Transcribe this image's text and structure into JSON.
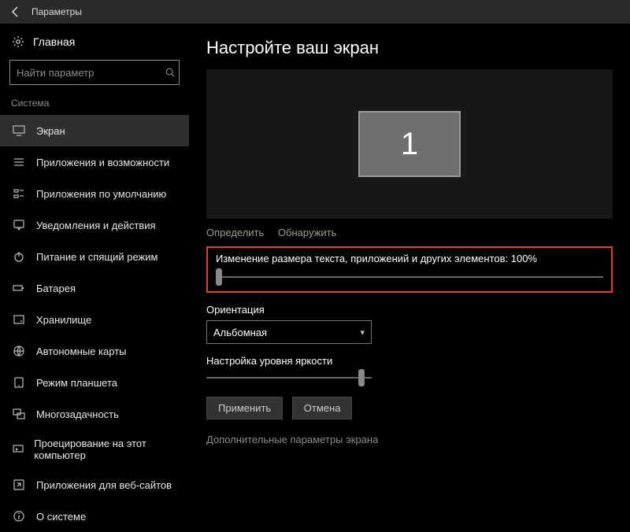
{
  "titlebar": {
    "title": "Параметры"
  },
  "sidebar": {
    "home": "Главная",
    "search_placeholder": "Найти параметр",
    "category": "Система",
    "items": [
      {
        "label": "Экран",
        "icon": "monitor-icon",
        "active": true
      },
      {
        "label": "Приложения и возможности",
        "icon": "apps-icon"
      },
      {
        "label": "Приложения по умолчанию",
        "icon": "defaults-icon"
      },
      {
        "label": "Уведомления и действия",
        "icon": "notifications-icon"
      },
      {
        "label": "Питание и спящий режим",
        "icon": "power-icon"
      },
      {
        "label": "Батарея",
        "icon": "battery-icon"
      },
      {
        "label": "Хранилище",
        "icon": "storage-icon"
      },
      {
        "label": "Автономные карты",
        "icon": "maps-icon"
      },
      {
        "label": "Режим планшета",
        "icon": "tablet-icon"
      },
      {
        "label": "Многозадачность",
        "icon": "multitask-icon"
      },
      {
        "label": "Проецирование на этот компьютер",
        "icon": "project-icon"
      },
      {
        "label": "Приложения для веб-сайтов",
        "icon": "weblink-icon"
      },
      {
        "label": "О системе",
        "icon": "about-icon"
      }
    ]
  },
  "content": {
    "heading": "Настройте ваш экран",
    "monitor_number": "1",
    "actions": {
      "identify": "Определить",
      "detect": "Обнаружить"
    },
    "scale_label": "Изменение размера текста, приложений и других элементов: 100%",
    "scale_value_pct": 0,
    "orientation_label": "Ориентация",
    "orientation_value": "Альбомная",
    "brightness_label": "Настройка уровня яркости",
    "brightness_value_pct": 92,
    "apply_btn": "Применить",
    "cancel_btn": "Отмена",
    "extra_link": "Дополнительные параметры экрана"
  }
}
